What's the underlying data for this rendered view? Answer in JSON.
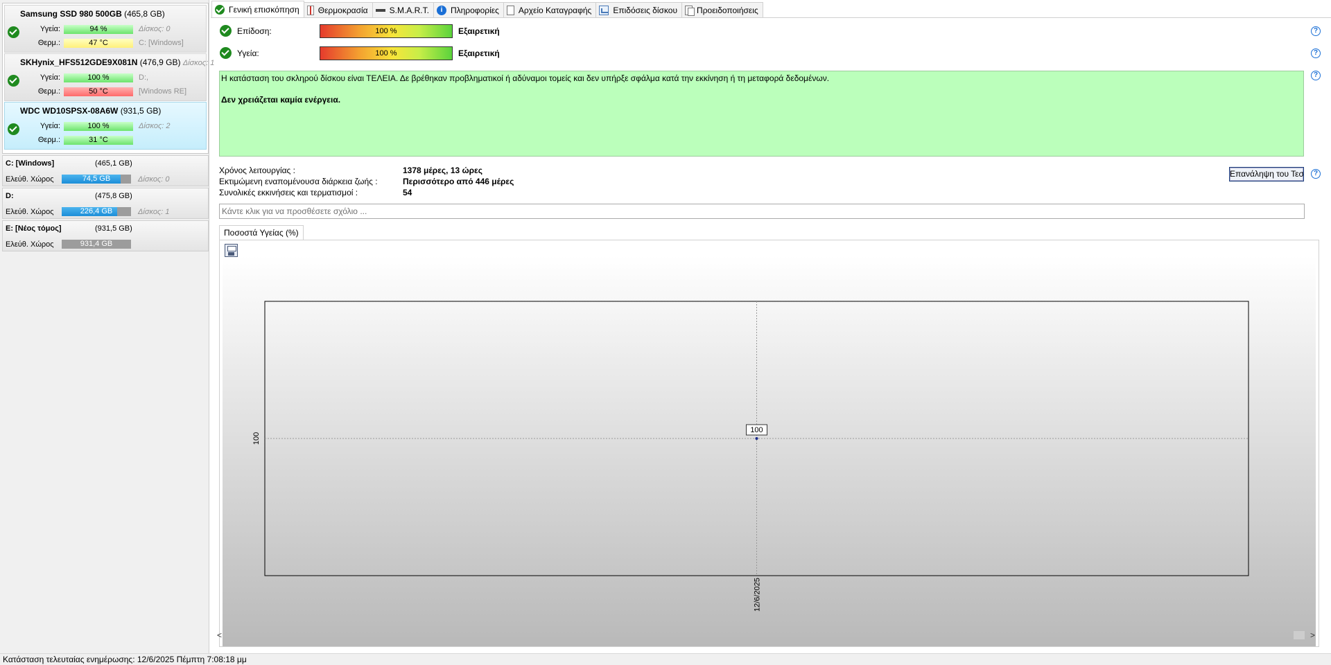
{
  "disks": [
    {
      "name": "Samsung SSD 980 500GB",
      "capacity": "(465,8 GB)",
      "health_label": "Υγεία:",
      "health_value": "94 %",
      "health_color": "green",
      "temp_label": "Θερμ.:",
      "temp_value": "47 °C",
      "temp_color": "yellow",
      "side1": "Δίσκος: 0",
      "side2": "C: [Windows]",
      "status_icon": "check-circle-icon"
    },
    {
      "name": "SKHynix_HFS512GDE9X081N",
      "capacity": "(476,9 GB)",
      "extra": "Δίσκος: 1",
      "health_label": "Υγεία:",
      "health_value": "100 %",
      "health_color": "green",
      "temp_label": "Θερμ.:",
      "temp_value": "50 °C",
      "temp_color": "red",
      "side1": "D:,",
      "side2": "[Windows RE]",
      "status_icon": "check-circle-icon"
    },
    {
      "name": "WDC WD10SPSX-08A6W",
      "capacity": "(931,5 GB)",
      "health_label": "Υγεία:",
      "health_value": "100 %",
      "health_color": "green",
      "temp_label": "Θερμ.:",
      "temp_value": "31 °C",
      "temp_color": "green",
      "side1": "Δίσκος: 2",
      "side2": "",
      "status_icon": "check-circle-icon"
    }
  ],
  "volumes": [
    {
      "name": "C: [Windows]",
      "capacity": "(465,1 GB)",
      "free_label": "Ελεύθ. Χώρος",
      "free_value": "74,5 GB",
      "free_fraction": 0.85,
      "disk": "Δίσκος: 0"
    },
    {
      "name": "D:",
      "capacity": "(475,8 GB)",
      "free_label": "Ελεύθ. Χώρος",
      "free_value": "226,4 GB",
      "free_fraction": 0.8,
      "disk": "Δίσκος: 1"
    },
    {
      "name": "E: [Νέος τόμος]",
      "capacity": "(931,5 GB)",
      "free_label": "Ελεύθ. Χώρος",
      "free_value": "931,4 GB",
      "free_fraction": 0.0,
      "disk": ""
    }
  ],
  "tabs": [
    {
      "label": "Γενική επισκόπηση",
      "icon": "check-circle-icon"
    },
    {
      "label": "Θερμοκρασία",
      "icon": "thermometer-icon"
    },
    {
      "label": "S.M.A.R.T.",
      "icon": "smart-icon"
    },
    {
      "label": "Πληροφορίες",
      "icon": "info-icon"
    },
    {
      "label": "Αρχείο Καταγραφής",
      "icon": "log-file-icon"
    },
    {
      "label": "Επιδόσεις δίσκου",
      "icon": "benchmark-chart-icon"
    },
    {
      "label": "Προειδοποιήσεις",
      "icon": "alerts-icon"
    }
  ],
  "overview": {
    "performance_label": "Επίδοση:",
    "performance_value": "100 %",
    "performance_rating": "Εξαιρετική",
    "health_label": "Υγεία:",
    "health_value": "100 %",
    "health_rating": "Εξαιρετική",
    "status_text": "Η κατάσταση του σκληρού δίσκου είναι ΤΕΛΕΙΑ. Δε βρέθηκαν προβληματικοί ή αδύναμοι τομείς και δεν υπήρξε σφάλμα κατά την εκκίνηση ή τη μεταφορά δεδομένων.",
    "status_action": "Δεν χρειάζεται καμία ενέργεια.",
    "uptime_label": "Χρόνος λειτουργίας :",
    "uptime_value": "1378 μέρες, 13 ώρες",
    "lifetime_label": "Εκτιμώμενη εναπομένουσα διάρκεια ζωής :",
    "lifetime_value": "Περισσότερο από 446 μέρες",
    "starts_label": "Συνολικές εκκινήσεις και τερματισμοί :",
    "starts_value": "54",
    "repeat_button": "Επανάληψη του Τεστ",
    "comment_placeholder": "Κάντε κλικ για να προσθέσετε σχόλιο ...",
    "help": "?"
  },
  "chart_tab_label": "Ποσοστά Υγείας (%)",
  "chart_data": {
    "type": "line",
    "x": [
      "12/6/2025"
    ],
    "series": [
      {
        "values": [
          100
        ]
      }
    ],
    "ytick": "100",
    "data_label": "100",
    "grid": true
  },
  "scroll": {
    "left": "<",
    "right": ">"
  },
  "statusbar": "Κατάσταση τελευταίας ενημέρωσης: 12/6/2025 Πέμπτη 7:08:18 μμ"
}
